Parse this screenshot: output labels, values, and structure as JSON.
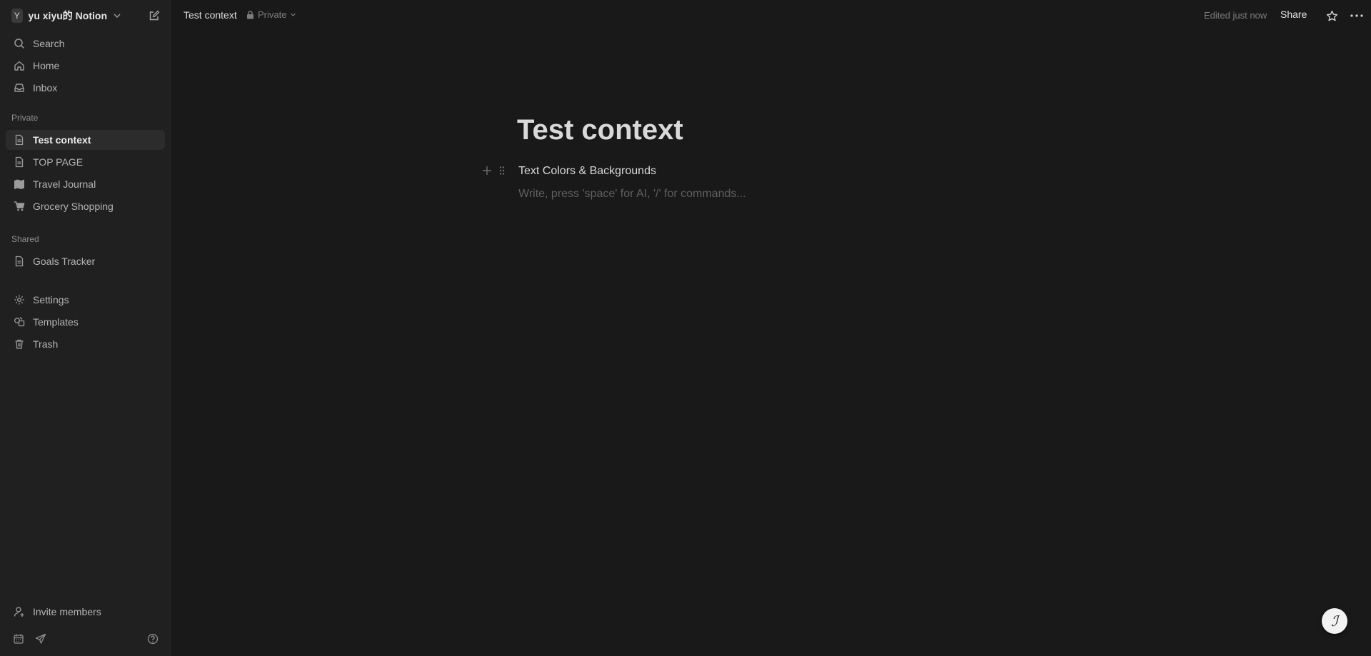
{
  "workspace": {
    "avatar_letter": "Y",
    "name": "yu xiyu的 Notion"
  },
  "sidebar": {
    "top_items": [
      {
        "label": "Search",
        "icon": "search-icon"
      },
      {
        "label": "Home",
        "icon": "home-icon"
      },
      {
        "label": "Inbox",
        "icon": "inbox-icon"
      }
    ],
    "private_label": "Private",
    "private_items": [
      {
        "label": "Test context",
        "icon": "page-icon",
        "active": true
      },
      {
        "label": "TOP PAGE",
        "icon": "page-icon"
      },
      {
        "label": "Travel Journal",
        "icon": "map-icon"
      },
      {
        "label": "Grocery Shopping",
        "icon": "cart-icon"
      }
    ],
    "shared_label": "Shared",
    "shared_items": [
      {
        "label": "Goals Tracker",
        "icon": "page-icon"
      }
    ],
    "utility_items": [
      {
        "label": "Settings",
        "icon": "gear-icon"
      },
      {
        "label": "Templates",
        "icon": "templates-icon"
      },
      {
        "label": "Trash",
        "icon": "trash-icon"
      }
    ],
    "invite_label": "Invite members"
  },
  "topbar": {
    "breadcrumb": "Test context",
    "privacy": "Private",
    "edited": "Edited just now",
    "share": "Share"
  },
  "page": {
    "title": "Test context",
    "blocks": [
      "Text Colors & Backgrounds"
    ],
    "placeholder": "Write, press 'space' for AI, '/' for commands..."
  },
  "colors": {
    "background": "#191919",
    "sidebar": "#202020",
    "active_item": "#2c2c2c"
  }
}
